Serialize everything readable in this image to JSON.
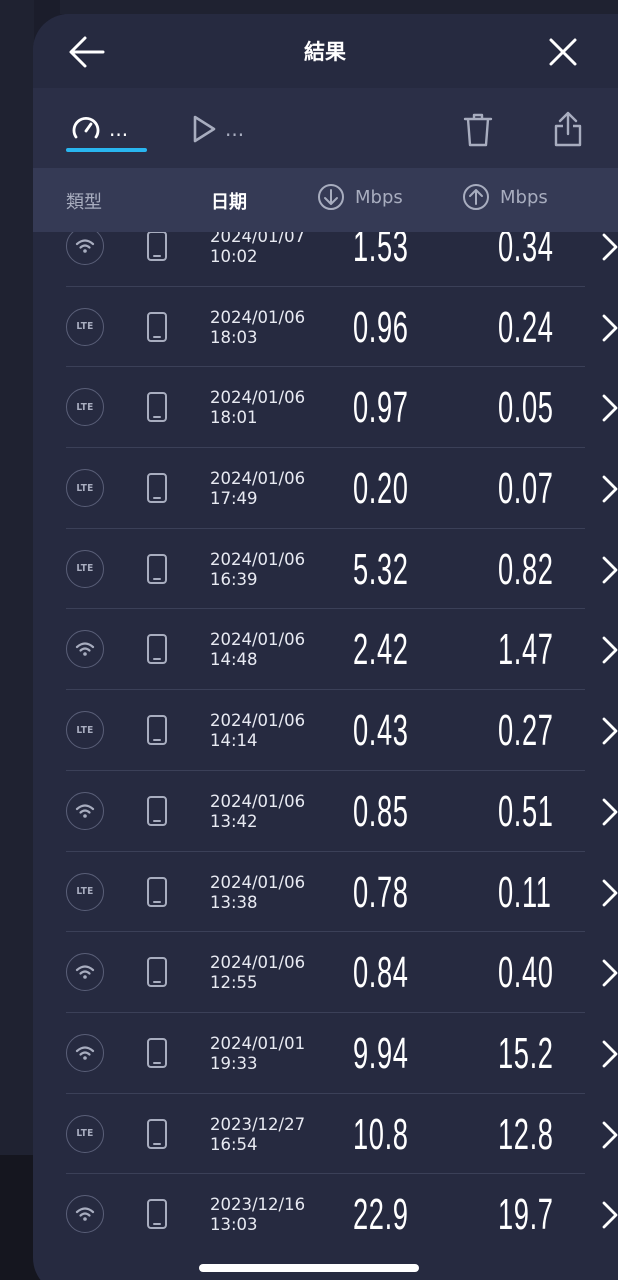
{
  "header": {
    "title": "結果",
    "back_icon": "arrow-left-icon",
    "close_icon": "close-icon"
  },
  "tabs": [
    {
      "icon": "speedometer-icon",
      "label": "...",
      "active": true
    },
    {
      "icon": "play-icon",
      "label": "...",
      "active": false
    }
  ],
  "toolbar": {
    "trash_icon": "trash-icon",
    "share_icon": "share-icon"
  },
  "columns": {
    "type": "類型",
    "date": "日期",
    "download": "Mbps",
    "upload": "Mbps"
  },
  "colors": {
    "accent": "#29b6f0",
    "background": "#262a40",
    "header_bg": "#353a55"
  },
  "results": [
    {
      "network": "wifi",
      "date": "2024/01/07",
      "time": "10:02",
      "down": "1.53",
      "up": "0.34"
    },
    {
      "network": "LTE",
      "date": "2024/01/06",
      "time": "18:03",
      "down": "0.96",
      "up": "0.24"
    },
    {
      "network": "LTE",
      "date": "2024/01/06",
      "time": "18:01",
      "down": "0.97",
      "up": "0.05"
    },
    {
      "network": "LTE",
      "date": "2024/01/06",
      "time": "17:49",
      "down": "0.20",
      "up": "0.07"
    },
    {
      "network": "LTE",
      "date": "2024/01/06",
      "time": "16:39",
      "down": "5.32",
      "up": "0.82"
    },
    {
      "network": "wifi",
      "date": "2024/01/06",
      "time": "14:48",
      "down": "2.42",
      "up": "1.47"
    },
    {
      "network": "LTE",
      "date": "2024/01/06",
      "time": "14:14",
      "down": "0.43",
      "up": "0.27"
    },
    {
      "network": "wifi",
      "date": "2024/01/06",
      "time": "13:42",
      "down": "0.85",
      "up": "0.51"
    },
    {
      "network": "LTE",
      "date": "2024/01/06",
      "time": "13:38",
      "down": "0.78",
      "up": "0.11"
    },
    {
      "network": "wifi",
      "date": "2024/01/06",
      "time": "12:55",
      "down": "0.84",
      "up": "0.40"
    },
    {
      "network": "wifi",
      "date": "2024/01/01",
      "time": "19:33",
      "down": "9.94",
      "up": "15.2"
    },
    {
      "network": "LTE",
      "date": "2023/12/27",
      "time": "16:54",
      "down": "10.8",
      "up": "12.8"
    },
    {
      "network": "wifi",
      "date": "2023/12/16",
      "time": "13:03",
      "down": "22.9",
      "up": "19.7"
    }
  ]
}
